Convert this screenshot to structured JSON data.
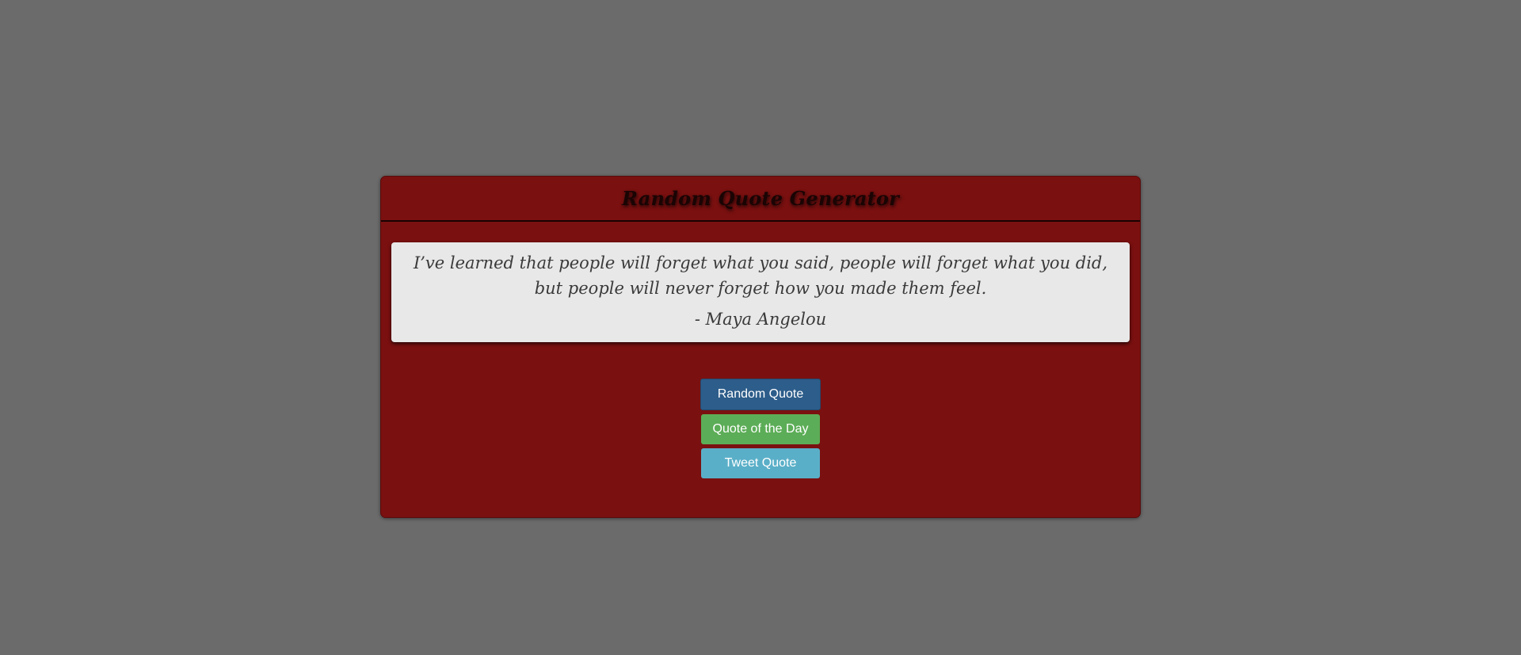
{
  "app": {
    "title": "Random Quote Generator"
  },
  "quote": {
    "text": "I’ve learned that people will forget what you said, people will forget what you did, but people will never forget how you made them feel.",
    "author": "- Maya Angelou"
  },
  "buttons": {
    "random_label": "Random Quote",
    "day_label": "Quote of the Day",
    "tweet_label": "Tweet Quote"
  },
  "colors": {
    "page_background": "#6b6b6b",
    "card_background": "#7a1010",
    "quote_background": "#e8e8e8",
    "random_button": "#2d5d8a",
    "day_button": "#5cad57",
    "tweet_button": "#5aafc8"
  }
}
